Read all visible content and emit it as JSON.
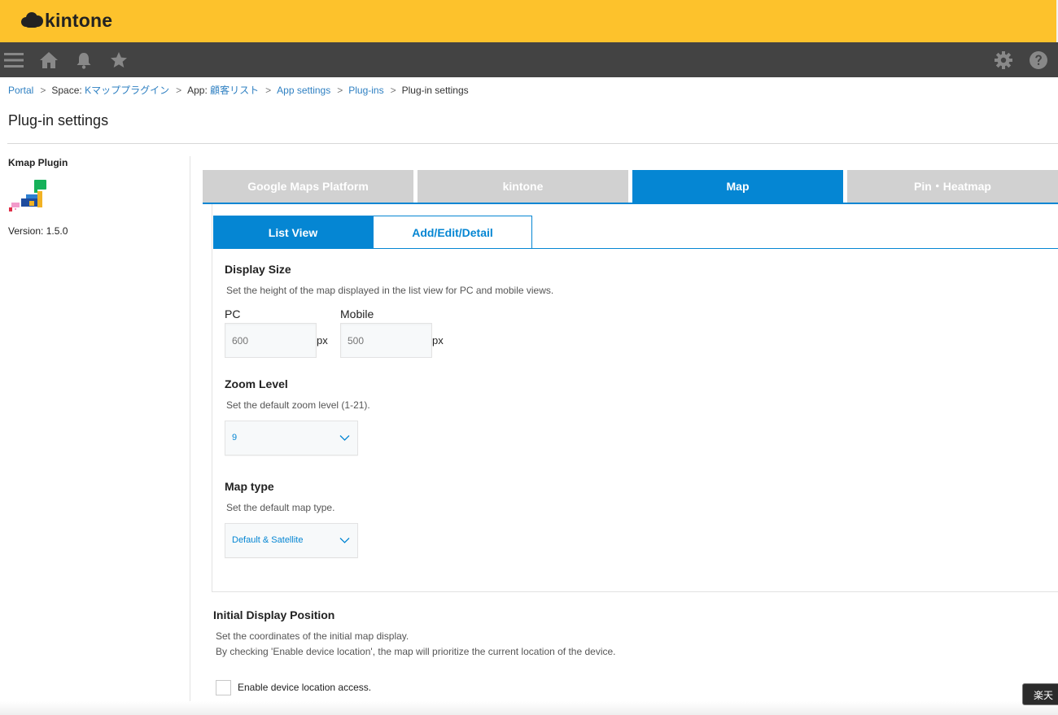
{
  "header": {
    "logo_text": "kintone",
    "brand_color": "#fdc22c",
    "nav_color": "#434343"
  },
  "nav": {
    "icons": [
      "menu-icon",
      "home-icon",
      "bell-icon",
      "star-icon",
      "gear-icon",
      "help-icon"
    ]
  },
  "breadcrumb": {
    "portal": "Portal",
    "space_prefix": "Space:",
    "space": "Kマッププラグイン",
    "app_prefix": "App:",
    "app": "顧客リスト",
    "app_settings": "App settings",
    "plugins": "Plug-ins",
    "current": "Plug-in settings",
    "separator": ">"
  },
  "page": {
    "title": "Plug-in settings"
  },
  "sidebar": {
    "plugin_name": "Kmap Plugin",
    "version_label": "Version: 1.5.0"
  },
  "tabs": [
    {
      "label": "Google Maps Platform",
      "active": false
    },
    {
      "label": "kintone",
      "active": false
    },
    {
      "label": "Map",
      "active": true
    },
    {
      "label": "Pin・Heatmap",
      "active": false
    }
  ],
  "subtabs": [
    {
      "label": "List View",
      "active": true
    },
    {
      "label": "Add/Edit/Detail",
      "active": false
    }
  ],
  "display_size": {
    "title": "Display Size",
    "description": "Set the height of the map displayed in the list view for PC and mobile views.",
    "pc_label": "PC",
    "pc_placeholder": "600",
    "mobile_label": "Mobile",
    "mobile_placeholder": "500",
    "unit": "px"
  },
  "zoom_level": {
    "title": "Zoom Level",
    "description": "Set the default zoom level (1-21).",
    "selected": "9"
  },
  "map_type": {
    "title": "Map type",
    "description": "Set the default map type.",
    "selected": "Default & Satellite"
  },
  "initial_position": {
    "title": "Initial Display Position",
    "description_1": "Set the coordinates of the initial map display.",
    "description_2": "By checking 'Enable device location', the map will prioritize the current location of the device.",
    "checkbox_label": "Enable device location access."
  },
  "tooltip": {
    "text": "楽天"
  },
  "colors": {
    "accent": "#0586d3",
    "tab_inactive": "#d1d1d1",
    "link": "#2f80c2"
  }
}
